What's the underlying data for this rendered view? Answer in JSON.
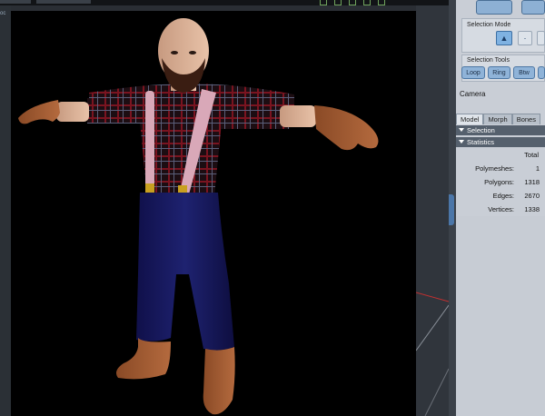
{
  "panel": {
    "selection_mode_title": "Selection Mode",
    "selection_tools_title": "Selection Tools",
    "tools": [
      "Loop",
      "Ring",
      "Btw"
    ],
    "camera_label": "Camera",
    "tabs": [
      "Model",
      "Morph",
      "Bones"
    ],
    "selection_header": "Selection",
    "statistics_header": "Statistics",
    "stats_column_header": "Total",
    "stats": [
      {
        "label": "Polymeshes:",
        "value": "1"
      },
      {
        "label": "Polygons:",
        "value": "1318"
      },
      {
        "label": "Edges:",
        "value": "2670"
      },
      {
        "label": "Vertices:",
        "value": "1338"
      }
    ]
  },
  "viewport": {
    "corner_mark": "oc"
  },
  "icons": {
    "mode_select": "triangle-select-icon",
    "mode_dot": "dot-icon",
    "mode_third": "mode-icon",
    "top_tool_1": "transform-icon",
    "top_tool_2": "tool-icon"
  },
  "colors": {
    "panel_bg": "#c9ced6",
    "button_blue": "#8fb3d8",
    "section_header": "#55606d",
    "viewport_bg": "#000000"
  }
}
